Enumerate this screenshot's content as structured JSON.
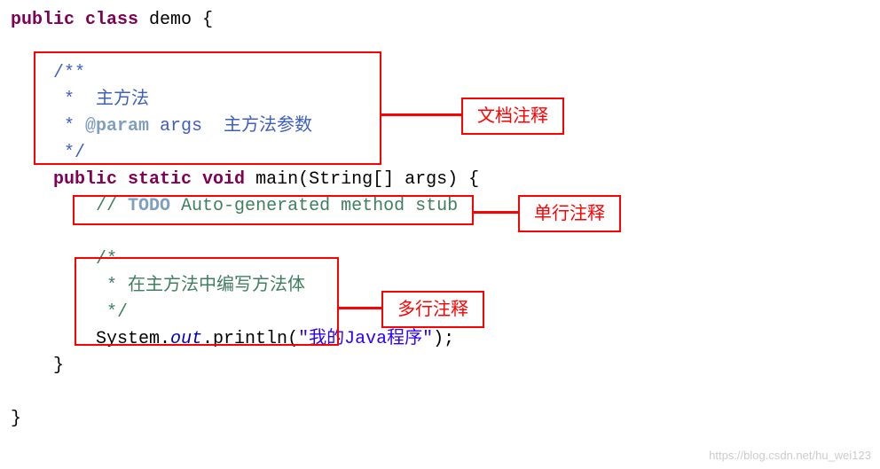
{
  "code": {
    "l1_kw1": "public",
    "l1_kw2": "class",
    "l1_name": " demo {",
    "blank": "",
    "doc1": "    /**",
    "doc2_a": "     *  ",
    "doc2_b": "主方法",
    "doc3_a": "     * ",
    "doc3_tag": "@param",
    "doc3_b": " args  ",
    "doc3_c": "主方法参数",
    "doc4": "     */",
    "main_a": "    ",
    "main_kw1": "public",
    "main_kw2": " static",
    "main_kw3": " void",
    "main_b": " main(String[] args) {",
    "todo_a": "        // ",
    "todo_b": "TODO",
    "todo_c": " Auto-generated method stub",
    "mc1": "        /*",
    "mc2": "         * 在主方法中编写方法体",
    "mc3": "         */",
    "sys_a": "        System.",
    "sys_b": "out",
    "sys_c": ".println(",
    "sys_str": "\"我的Java程序\"",
    "sys_d": ");",
    "close1": "    }",
    "close2": "}"
  },
  "labels": {
    "doc_comment": "文档注释",
    "single_comment": "单行注释",
    "multi_comment": "多行注释"
  },
  "watermark": "https://blog.csdn.net/hu_wei123"
}
